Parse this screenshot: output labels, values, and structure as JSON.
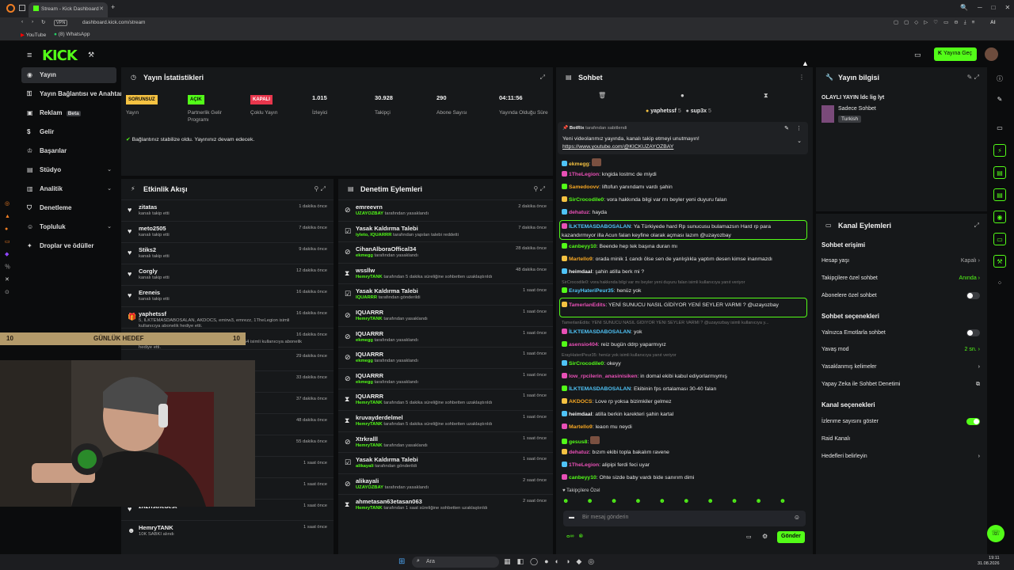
{
  "browser": {
    "tab_title": "Stream - Kick Dashboard",
    "url": "dashboard.kick.com/stream",
    "vpn_label": "VPN",
    "ai_label": "AI",
    "bookmarks": [
      "YouTube",
      "(8) WhatsApp"
    ]
  },
  "header": {
    "logo": "KICK",
    "go_live_label": "Yayına Geç"
  },
  "nav": {
    "items": [
      {
        "label": "Yayın",
        "icon": "broadcast-icon"
      },
      {
        "label": "Yayın Bağlantısı ve Anahtarı",
        "icon": "key-icon"
      },
      {
        "label": "Reklam",
        "icon": "ad-icon",
        "badge": "Beta"
      },
      {
        "label": "Gelir",
        "icon": "dollar-icon"
      },
      {
        "label": "Başarılar",
        "icon": "trophy-icon"
      },
      {
        "label": "Stüdyo",
        "icon": "studio-icon"
      },
      {
        "label": "Analitik",
        "icon": "chart-icon"
      },
      {
        "label": "Denetleme",
        "icon": "shield-icon"
      },
      {
        "label": "Topluluk",
        "icon": "users-icon"
      },
      {
        "label": "Droplar ve ödüller",
        "icon": "gift-icon"
      }
    ]
  },
  "stats": {
    "title": "Yayın İstatistikleri",
    "items": [
      {
        "badge": "SORUNSUZ",
        "label": "Yayın",
        "color": "#f5c242"
      },
      {
        "badge": "AÇIK",
        "label": "Partnerlik Gelir Programı",
        "color": "#53fc18"
      },
      {
        "badge": "KAPALI",
        "label": "Çoklu Yayın",
        "color": "#e8364c"
      },
      {
        "value": "1.015",
        "label": "İzleyici"
      },
      {
        "value": "30.928",
        "label": "Takipçi"
      },
      {
        "value": "290",
        "label": "Abone Sayısı"
      },
      {
        "value": "04:11:56",
        "label": "Yayında Olduğu Süre"
      }
    ],
    "connection_msg": "Bağlantınız stabilize oldu. Yayınınız devam edecek."
  },
  "activity": {
    "title": "Etkinlik Akışı",
    "rows": [
      {
        "name": "zitatas",
        "sub": "kanalı takip etti",
        "time": "1 dakika önce",
        "icon": "heart-icon"
      },
      {
        "name": "meto2505",
        "sub": "kanalı takip etti",
        "time": "7 dakika önce",
        "icon": "heart-icon"
      },
      {
        "name": "Stiks2",
        "sub": "kanalı takip etti",
        "time": "9 dakika önce",
        "icon": "heart-icon"
      },
      {
        "name": "Corgly",
        "sub": "kanalı takip etti",
        "time": "12 dakika önce",
        "icon": "heart-icon"
      },
      {
        "name": "Ereneis",
        "sub": "kanalı takip etti",
        "time": "16 dakika önce",
        "icon": "heart-icon"
      },
      {
        "name": "yaphetssf",
        "sub": "5, İLKTEMASDABOSALAN, AKDOCS, emirw3, emrezz, 1TheLegion isimli kullanıcıya abonelik hediye etti.",
        "time": "16 dakika önce",
        "icon": "gift-icon"
      }
    ],
    "rows_tail": [
      {
        "name": "",
        "sub": "5, Rrreeney, lmberx, Memocan67, kayyrras, MAMW54 isimli kullanıcıya abonelik hediye etti.",
        "time": "16 dakika önce"
      },
      {
        "name": "",
        "sub": "",
        "time": "29 dakika önce"
      },
      {
        "name": "",
        "sub": "",
        "time": "33 dakika önce"
      },
      {
        "name": "",
        "sub": "",
        "time": "37 dakika önce"
      },
      {
        "name": "",
        "sub": "",
        "time": "48 dakika önce"
      },
      {
        "name": "",
        "sub": "",
        "time": "55 dakika önce"
      },
      {
        "name": "",
        "sub": "",
        "time": "1 saat önce"
      },
      {
        "name": "",
        "sub": "",
        "time": "1 saat önce"
      },
      {
        "name": "zh2risthebest",
        "sub": "",
        "time": "1 saat önce",
        "icon": "heart-icon"
      },
      {
        "name": "HemryTANK",
        "sub": "10K SABKI alındı",
        "time": "1 saat önce",
        "icon": "user-icon"
      }
    ]
  },
  "moderation": {
    "title": "Denetim Eylemleri",
    "rows": [
      {
        "name": "emreevrn",
        "mod": "UZAYOZBAY",
        "action": "tarafından yasaklandı",
        "time": "2 dakika önce",
        "icon": "ban-icon"
      },
      {
        "name": "Yasak Kaldırma Talebi",
        "mod": "iyleto, IQUARRR",
        "action": "tarafından yapılan talebi reddetti",
        "time": "7 dakika önce",
        "icon": "request-icon"
      },
      {
        "name": "CihanAlboraOffical34",
        "mod": "ekmegg",
        "action": "tarafından yasaklandı",
        "time": "28 dakika önce",
        "icon": "ban-icon"
      },
      {
        "name": "wssllw",
        "mod": "HemryTANK",
        "action": "tarafından 5 dakika süreliğine sohbetten uzaklaştırıldı",
        "time": "48 dakika önce",
        "icon": "timer-icon"
      },
      {
        "name": "Yasak Kaldırma Talebi",
        "mod": "IQUARRR",
        "action": "tarafından gönderildi",
        "time": "1 saat önce",
        "icon": "request-icon"
      },
      {
        "name": "IQUARRR",
        "mod": "HemryTANK",
        "action": "tarafından yasaklandı",
        "time": "1 saat önce",
        "icon": "ban-icon"
      },
      {
        "name": "IQUARRR",
        "mod": "ekmegg",
        "action": "tarafından yasaklandı",
        "time": "1 saat önce",
        "icon": "ban-icon"
      },
      {
        "name": "IQUARRR",
        "mod": "ekmegg",
        "action": "tarafından yasaklandı",
        "time": "1 saat önce",
        "icon": "ban-icon"
      },
      {
        "name": "IQUARRR",
        "mod": "ekmegg",
        "action": "tarafından yasaklandı",
        "time": "1 saat önce",
        "icon": "ban-icon"
      },
      {
        "name": "IQUARRR",
        "mod": "HemryTANK",
        "action": "tarafından 5 dakika süreliğine sohbetten uzaklaştırıldı",
        "time": "1 saat önce",
        "icon": "timer-icon"
      },
      {
        "name": "kruvayderdelmel",
        "mod": "HemryTANK",
        "action": "tarafından 5 dakika süreliğine sohbetten uzaklaştırıldı",
        "time": "1 saat önce",
        "icon": "timer-icon"
      },
      {
        "name": "Xtrkralll",
        "mod": "HemryTANK",
        "action": "tarafından yasaklandı",
        "time": "1 saat önce",
        "icon": "ban-icon"
      },
      {
        "name": "Yasak Kaldırma Talebi",
        "mod": "alikayali",
        "action": "tarafından gönderildi",
        "time": "1 saat önce",
        "icon": "request-icon"
      },
      {
        "name": "alikayali",
        "mod": "UZAYOZBAY",
        "action": "tarafından yasaklandı",
        "time": "2 saat önce",
        "icon": "ban-icon"
      },
      {
        "name": "ahmetasan63etasan063",
        "mod": "HemryTANK",
        "action": "tarafından 1 saat süreliğine sohbetten uzaklaştırıldı",
        "time": "2 saat önce",
        "icon": "timer-icon"
      }
    ]
  },
  "chat": {
    "title": "Sohbet",
    "top_users": [
      {
        "name": "yaphetssf",
        "count": "5"
      },
      {
        "name": "sup3x",
        "count": "5"
      }
    ],
    "pinned": {
      "by": "BotRix",
      "by_suffix": "tarafından sabitlendi",
      "text": "Yeni videolarımız yayında, kanalı takip etmeyi unutmayın!",
      "link": "https://www.youtube.com/@KICKUZAYOZBAY"
    },
    "messages": [
      {
        "user": "ekmegg",
        "text": "",
        "color": "#f5c242"
      },
      {
        "user": "1TheLegion",
        "text": "kngida lostmc de miydi",
        "color": "#e850b6"
      },
      {
        "user": "Samedoovv",
        "text": "liftofun yanındamı vardı şahin",
        "color": "#f5a623"
      },
      {
        "user": "SirCrocodile0",
        "text": "vora hakkında bilgi var mı beyler yeni duyuru falan",
        "color": "#53fc18"
      },
      {
        "user": "dehatuz",
        "text": "hayda",
        "color": "#e850b6"
      },
      {
        "user": "İLKTEMASDABOSALAN",
        "text": "Ya Türkiyede hard Rp sunucusu bulamazsın Hard rp para kazandırmıyor illa Acun falan keyfine olarak açması lazım @uzayozbay",
        "color": "#4fc3f7",
        "highlight": true
      },
      {
        "user": "canbeyy10",
        "text": "Beende hep tek başına duran mı",
        "color": "#53fc18"
      },
      {
        "user": "Martello9",
        "text": "orada minik 1 candı ölse sen de yanlışlıkla yaptım desen kimse inanmazdı",
        "color": "#f5a623"
      },
      {
        "user": "heimdaal",
        "text": "şahin atilla berk mi ?",
        "color": "#f0f0f0"
      },
      {
        "user": "SirCrocodile0",
        "text": "vora hakkında bilgi var mı beyler yeni duyuru falan isimli kullanıcıya yanıt veriyor",
        "system": true
      },
      {
        "user": "ErayHateriPeur35",
        "text": "henüz yok",
        "color": "#4fc3f7"
      },
      {
        "user": "TamerlanEdits",
        "text": "YENİ SUNUCU NASIL GİDİYOR YENİ SEYLER VARMI ? @uzayozbay",
        "color": "#e850b6",
        "highlight": true
      },
      {
        "user": "TamerlanEdits",
        "text": "YENİ SUNUCU NASIL GİDİYOR YENİ SEYLER VARMI ? @uzayozbay isimli kullanıcıya y...",
        "system": true
      },
      {
        "user": "İLKTEMASDABOSALAN",
        "text": "yok",
        "color": "#4fc3f7"
      },
      {
        "user": "asensio404",
        "text": "reiz bugün ddrp yaparmıyız",
        "color": "#e850b6"
      },
      {
        "user": "ErayHateriPeur35",
        "text": "henüz yok isimli kullanıcıya yanıt veriyor",
        "system": true
      },
      {
        "user": "SirCrocodile0",
        "text": "okeyy",
        "color": "#53fc18"
      },
      {
        "user": "low_rpcilerin_anasinisiken",
        "text": "in domal ekibi kabul ediyorlarmıymış",
        "color": "#e850b6"
      },
      {
        "user": "İLKTEMASDABOSALAN",
        "text": "Ekibinin fps ortalaması 30-40 falan",
        "color": "#4fc3f7"
      },
      {
        "user": "AKDOCS",
        "text": "Love rp yoksa bizimkiler gelmez",
        "color": "#f5a623"
      },
      {
        "user": "heimdaal",
        "text": "atilla berkin karekteri şahin kartal",
        "color": "#f0f0f0"
      },
      {
        "user": "Martello9",
        "text": "leaon mu neydi",
        "color": "#f5a623"
      },
      {
        "user": "gesus8",
        "text": "",
        "color": "#53fc18"
      },
      {
        "user": "dehatuz",
        "text": "bızım ekibi topla bakalım ravene",
        "color": "#e850b6"
      },
      {
        "user": "1TheLegion",
        "text": "alipipi ferdi feci uyar",
        "color": "#e850b6"
      },
      {
        "user": "canbeyy10",
        "text": "Ohte sizde baby vardı bide sanırım dimi",
        "color": "#53fc18"
      }
    ],
    "followers_only_label": "Takipçilere Özel",
    "input_placeholder": "Bir mesaj gönderin",
    "send_label": "Gönder"
  },
  "stream_info": {
    "title": "Yayın bilgisi",
    "stream_title": "OLAYLI YAYIN ldc lig lyt",
    "category": "Sadece Sohbet",
    "language": "Turkish"
  },
  "channel_actions": {
    "title": "Kanal Eylemleri",
    "chat_access_title": "Sohbet erişimi",
    "chat_access": [
      {
        "label": "Hesap yaşı",
        "value": "Kapalı"
      },
      {
        "label": "Takipçilere özel sohbet",
        "value": "Anında"
      },
      {
        "label": "Abonelere özel sohbet",
        "toggle": false
      }
    ],
    "chat_options_title": "Sohbet seçenekleri",
    "chat_options": [
      {
        "label": "Yalnızca Emotlarla sohbet",
        "toggle": false
      },
      {
        "label": "Yavaş mod",
        "value": "2 sn."
      },
      {
        "label": "Yasaklanmış kelimeler",
        "value": ""
      },
      {
        "label": "Yapay Zeka ile Sohbet Denetimi",
        "value": ""
      }
    ],
    "channel_options_title": "Kanal seçenekleri",
    "channel_options": [
      {
        "label": "İzlenme sayısını göster",
        "toggle": true
      },
      {
        "label": "Raid Kanalı",
        "value": ""
      },
      {
        "label": "Hedefleri belirleyin",
        "value": ""
      }
    ]
  },
  "overlay": {
    "goal_left": "10",
    "goal_title": "GÜNLÜK HEDEF",
    "goal_right": "10"
  },
  "taskbar": {
    "search_placeholder": "Ara",
    "time": "19:11",
    "date": "31.08.2026"
  }
}
